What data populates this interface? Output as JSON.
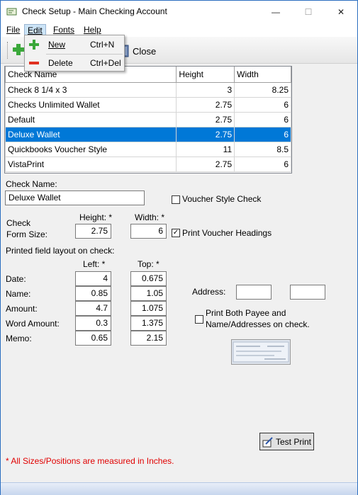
{
  "window": {
    "title": "Check Setup - Main Checking Account",
    "min": "—",
    "max": "☐",
    "close": "✕"
  },
  "menu": {
    "file": "File",
    "edit": "Edit",
    "fonts": "Fonts",
    "help": "Help"
  },
  "edit_menu": {
    "new_label": "New",
    "new_shortcut": "Ctrl+N",
    "delete_label": "Delete",
    "delete_shortcut": "Ctrl+Del"
  },
  "toolbar": {
    "close_label": "Close"
  },
  "grid": {
    "headers": [
      "Check Name",
      "Height",
      "Width"
    ],
    "rows": [
      [
        "Check 8 1/4 x 3",
        "3",
        "8.25"
      ],
      [
        "Checks Unlimited Wallet",
        "2.75",
        "6"
      ],
      [
        "Default",
        "2.75",
        "6"
      ],
      [
        "Deluxe Wallet",
        "2.75",
        "6"
      ],
      [
        "Quickbooks Voucher Style",
        "11",
        "8.5"
      ],
      [
        "VistaPrint",
        "2.75",
        "6"
      ]
    ]
  },
  "form": {
    "check_name_label": "Check Name:",
    "check_name_value": "Deluxe Wallet",
    "voucher_style_label": "Voucher Style Check",
    "check_form_size_label_1": "Check",
    "check_form_size_label_2": "Form Size:",
    "height_label": "Height: *",
    "width_label": "Width: *",
    "height_value": "2.75",
    "width_value": "6",
    "print_voucher_headings_label": "Print Voucher Headings",
    "layout_label": "Printed field layout on check:",
    "left_label": "Left: *",
    "top_label": "Top: *",
    "fields": [
      {
        "label": "Date:",
        "left": "4",
        "top": "0.675"
      },
      {
        "label": "Name:",
        "left": "0.85",
        "top": "1.05"
      },
      {
        "label": "Amount:",
        "left": "4.7",
        "top": "1.075"
      },
      {
        "label": "Word Amount:",
        "left": "0.3",
        "top": "1.375"
      },
      {
        "label": "Memo:",
        "left": "0.65",
        "top": "2.15"
      }
    ],
    "address_label": "Address:",
    "print_both_label_1": "Print Both Payee and",
    "print_both_label_2": "Name/Addresses on check.",
    "test_print_label": "Test Print",
    "footnote": "* All Sizes/Positions are measured in Inches."
  },
  "colors": {
    "selection": "#0078d7",
    "footnote": "#e00000"
  }
}
